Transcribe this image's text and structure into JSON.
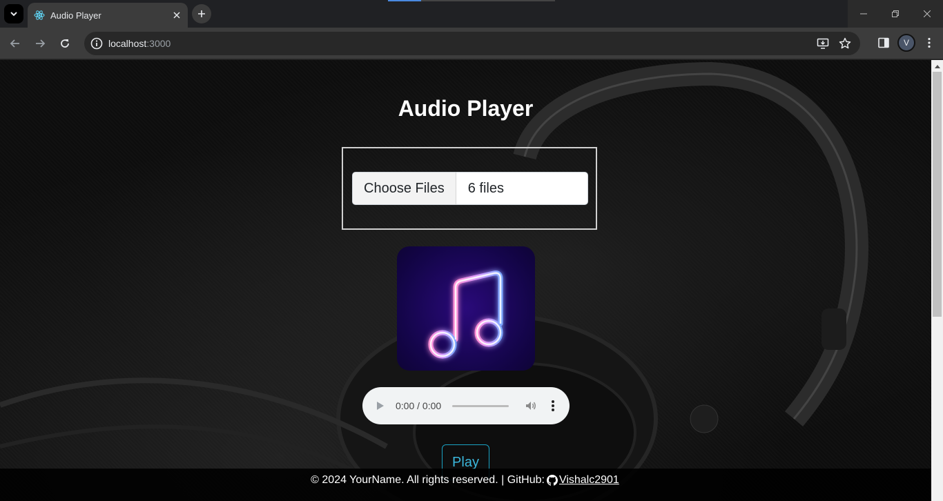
{
  "browser": {
    "tab_title": "Audio Player",
    "url_host": "localhost",
    "url_port": ":3000",
    "profile_initial": "V"
  },
  "page": {
    "title": "Audio Player",
    "file_input": {
      "button_label": "Choose Files",
      "status": "6 files"
    },
    "audio": {
      "time": "0:00 / 0:00"
    },
    "play_button": "Play",
    "footer": {
      "text": "© 2024 YourName. All rights reserved. | GitHub:",
      "github_user": "Vishalc2901"
    }
  },
  "colors": {
    "accent": "#3bb7dc",
    "cover_bg": "#14054a"
  }
}
